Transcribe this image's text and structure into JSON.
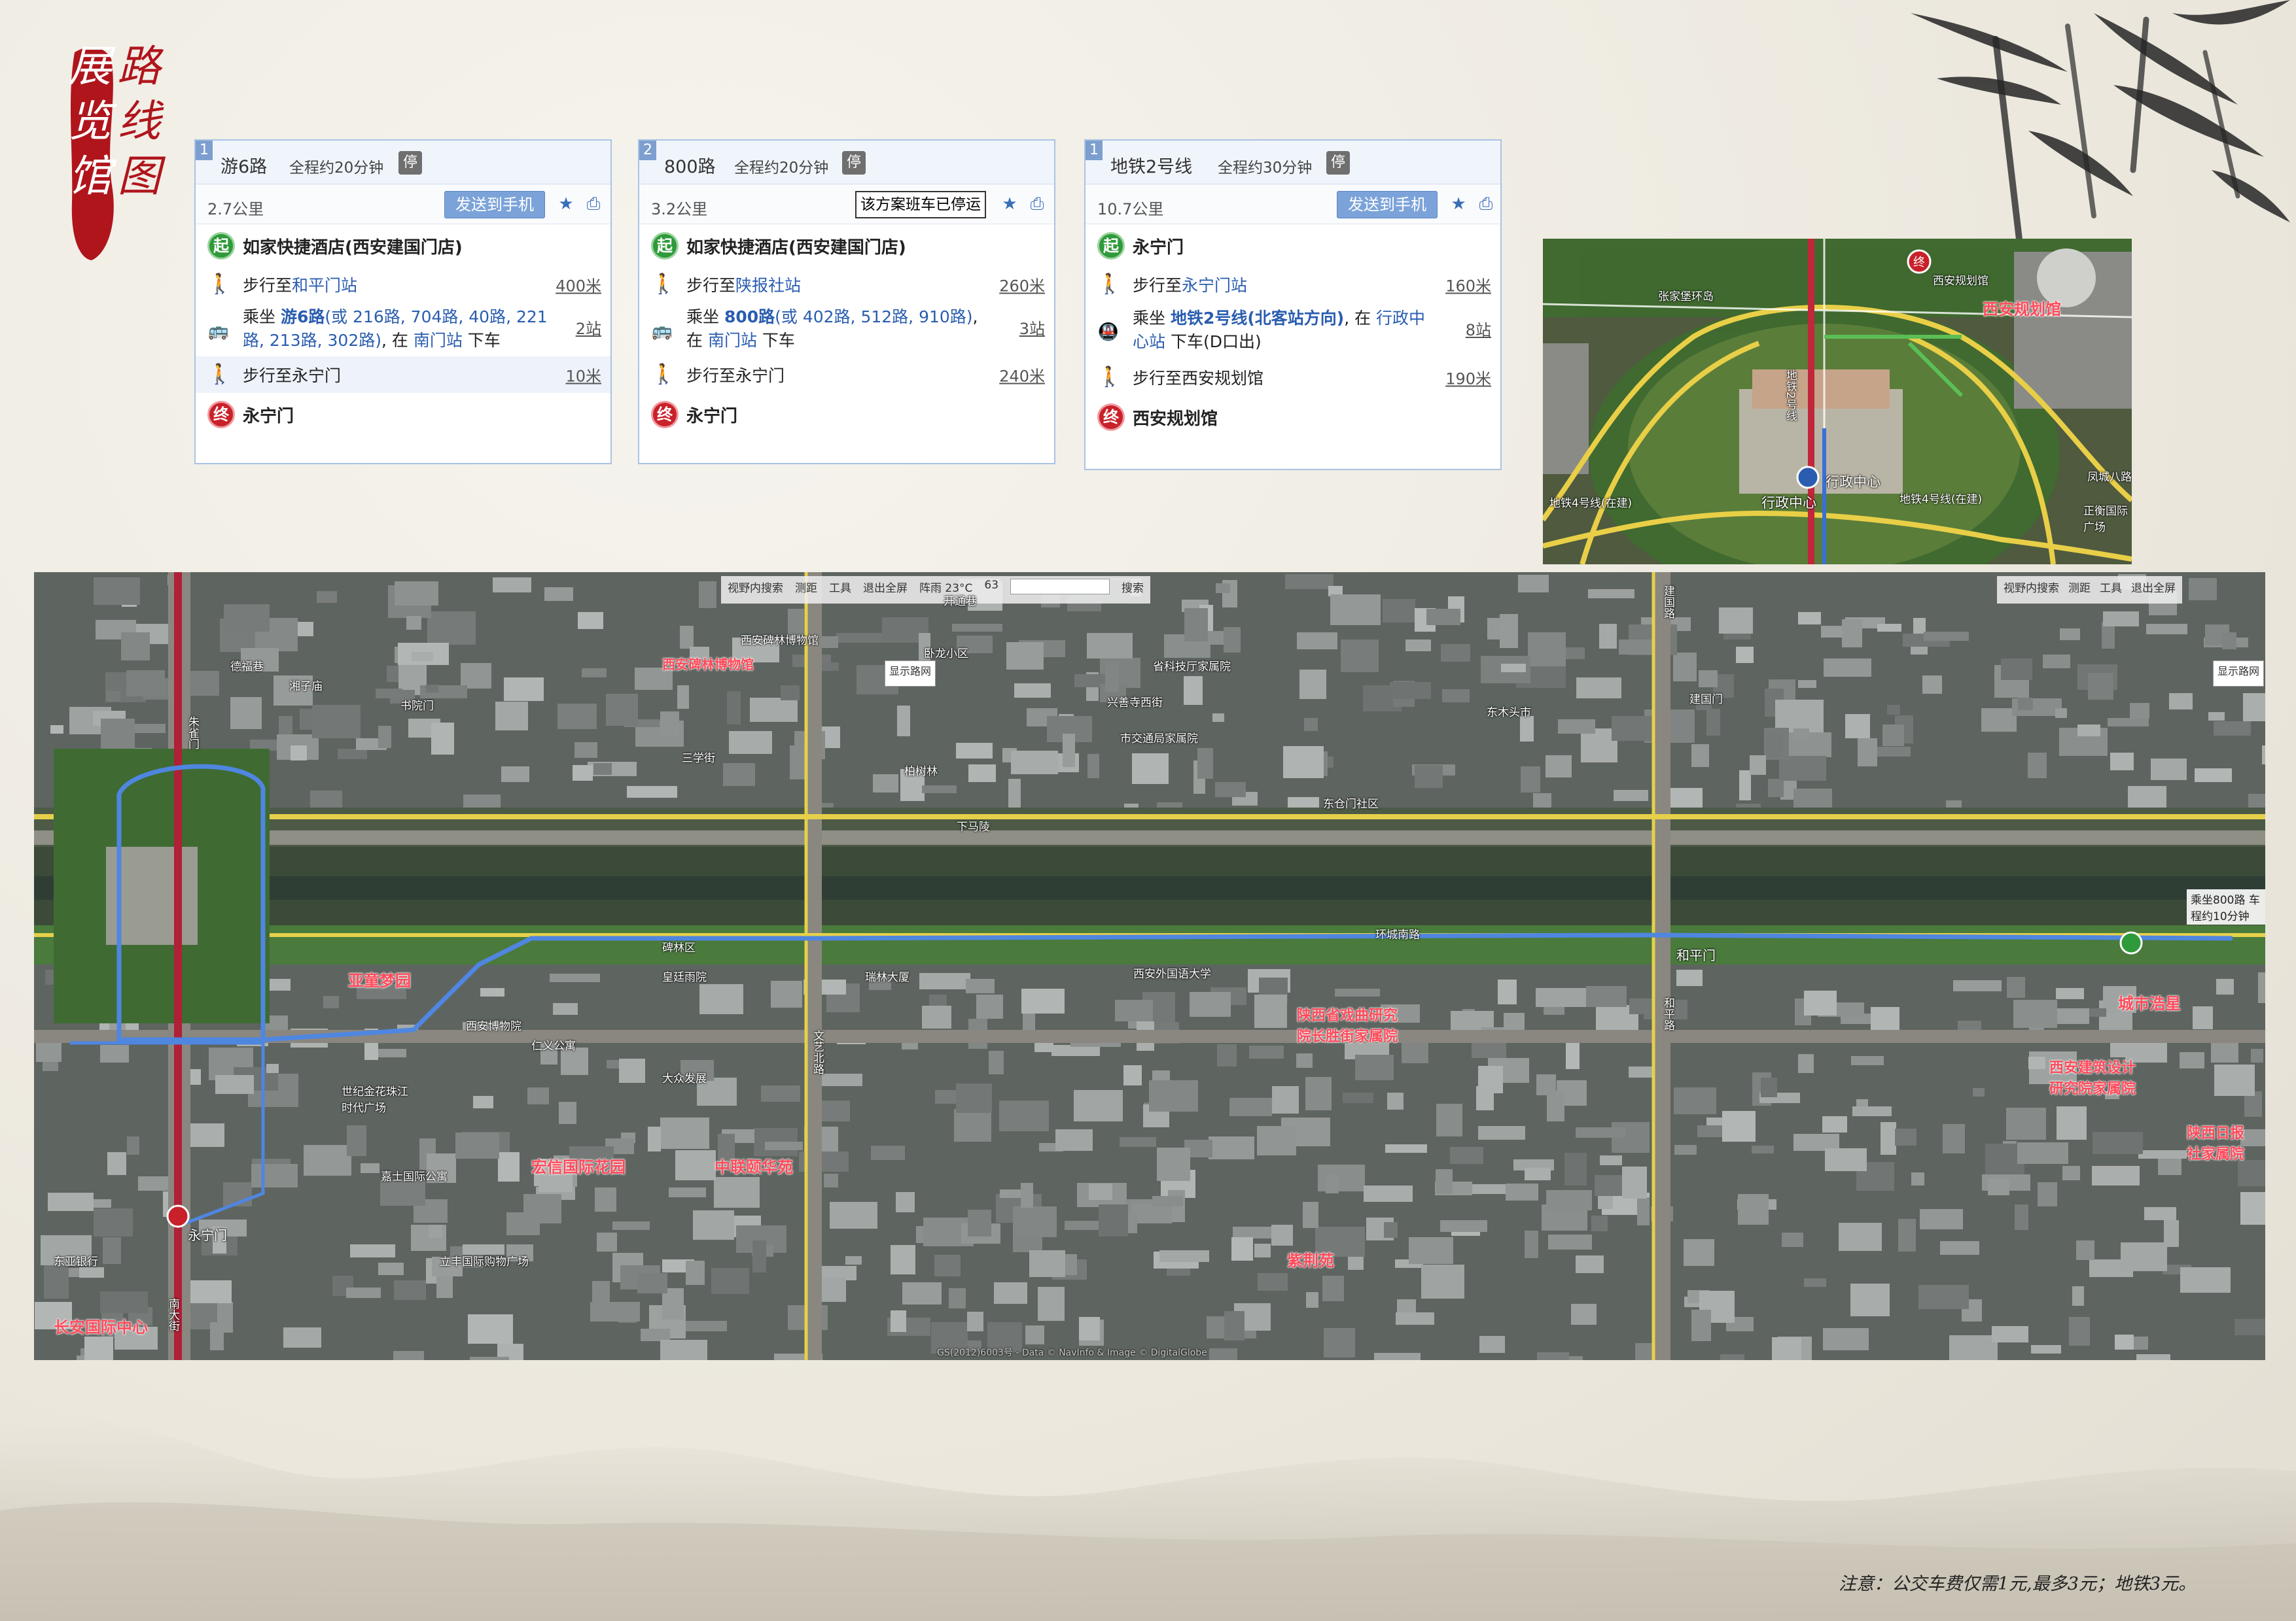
{
  "title": {
    "chars": [
      "展",
      "览",
      "馆",
      "路",
      "线",
      "图"
    ]
  },
  "routes": [
    {
      "num": "1",
      "name": "游6路",
      "time": "全程约20分钟",
      "stop_icon": "停",
      "distance": "2.7公里",
      "send": "发送到手机",
      "start": "如家快捷酒店(西安建国门店)",
      "walk1": {
        "pre": "步行至 ",
        "target": "和平门站",
        "dist": "400米"
      },
      "ride": {
        "pre": "乘坐 ",
        "line": "游6路",
        "alt": "(或 216路, 704路, 40路, 221路, 213路, 302路)",
        "mid": ", 在 ",
        "stop": "南门站",
        "post": " 下车",
        "stops": "2站"
      },
      "walk2": {
        "pre": "步行至 ",
        "target": "永宁门",
        "dist": "10米"
      },
      "end": "永宁门"
    },
    {
      "num": "2",
      "name": "800路",
      "time": "全程约20分钟",
      "stop_icon": "停",
      "distance": "3.2公里",
      "tooltip": "该方案班车已停运",
      "start": "如家快捷酒店(西安建国门店)",
      "walk1": {
        "pre": "步行至 ",
        "target": "陕报社站",
        "dist": "260米"
      },
      "ride": {
        "pre": "乘坐 ",
        "line": "800路",
        "alt": "(或 402路, 512路, 910路)",
        "mid": ", 在 ",
        "stop": "南门站",
        "post": " 下车",
        "stops": "3站"
      },
      "walk2": {
        "pre": "步行至 ",
        "target": "永宁门",
        "dist": "240米"
      },
      "end": "永宁门"
    },
    {
      "num": "1",
      "name": "地铁2号线",
      "time": "全程约30分钟",
      "stop_icon": "停",
      "distance": "10.7公里",
      "send": "发送到手机",
      "start": "永宁门",
      "walk1": {
        "pre": "步行至 ",
        "target": "永宁门站",
        "dist": "160米"
      },
      "ride": {
        "pre": "乘坐 ",
        "line": "地铁2号线(北客站方向)",
        "alt": "",
        "mid": ", 在 ",
        "stop": "行政中心站",
        "post": " 下车(D口出)",
        "stops": "8站"
      },
      "walk2": {
        "pre": "步行至 ",
        "target": "西安规划馆",
        "dist": "190米"
      },
      "end": "西安规划馆"
    }
  ],
  "badges": {
    "start": "起",
    "end": "终"
  },
  "inset_labels": {
    "planning_hall": "西安规划馆",
    "admin_center": "行政中心",
    "admin_center2": "行政中心",
    "metro2": "地铁2号线",
    "metro4": "地铁4号线(在建)",
    "metro4b": "地铁4号线(在建)",
    "ring": "张家堡环岛",
    "fengcheng": "凤城八路",
    "zhengheng": "正衡国际广场",
    "xian_plan_small": "西安规划馆"
  },
  "toolbar": {
    "items": [
      "视野内搜索",
      "测距",
      "工具",
      "退出全屏",
      "阵雨 23°C",
      "63",
      "搜索"
    ],
    "items2": [
      "视野内搜索",
      "测距",
      "工具",
      "退出全屏"
    ],
    "traffic": "显示路网"
  },
  "map_labels": {
    "red": [
      "亚童梦园",
      "宏信国际花园",
      "中联颐华苑",
      "紫荆苑",
      "陕西省戏曲研究院长胜街家属院",
      "城市浩星",
      "西安建筑设计研究院家属院",
      "陕西日报社家属院",
      "长安国际中心",
      "西安碑林博物馆"
    ],
    "white": [
      "西安碑林博物馆",
      "卧龙小区",
      "省科技厅家属院",
      "市交通局家属院",
      "西安外国语大学",
      "东仓门社区",
      "环城南路",
      "和平门",
      "永宁门",
      "南门",
      "文艺北路",
      "南大街",
      "和平路",
      "建国路",
      "书院门",
      "碑林区",
      "皇廷雨院",
      "瑞林大厦",
      "仁义公寓",
      "大众发展",
      "嘉士国际公寓",
      "东亚银行",
      "立丰国际购物广场",
      "世纪金花珠江时代广场",
      "西安博物院",
      "朱雀门",
      "德福巷",
      "湘子庙",
      "三学街",
      "下马陵",
      "东木头市",
      "柏树林",
      "建国门",
      "开通巷",
      "兴善寺西街"
    ],
    "bus_note": "乘坐800路 车程约10分钟",
    "copyright": "GS(2012)6003号 - Data © NavInfo & Image © DigitalGlobe"
  },
  "note": "注意：公交车费仅需1元,最多3元；地铁3元。"
}
